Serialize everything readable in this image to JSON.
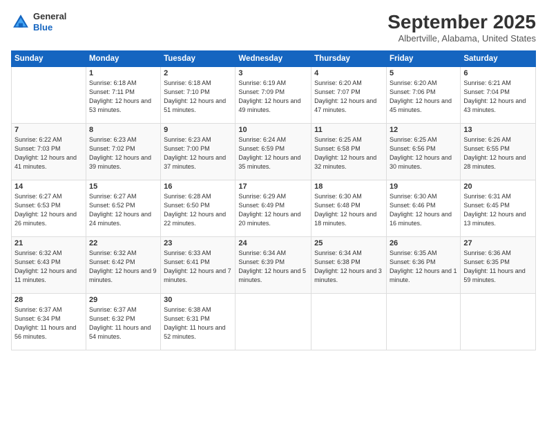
{
  "header": {
    "logo": {
      "general": "General",
      "blue": "Blue"
    },
    "title": "September 2025",
    "location": "Albertville, Alabama, United States"
  },
  "weekdays": [
    "Sunday",
    "Monday",
    "Tuesday",
    "Wednesday",
    "Thursday",
    "Friday",
    "Saturday"
  ],
  "weeks": [
    [
      {
        "day": "",
        "info": ""
      },
      {
        "day": "1",
        "info": "Sunrise: 6:18 AM\nSunset: 7:11 PM\nDaylight: 12 hours\nand 53 minutes."
      },
      {
        "day": "2",
        "info": "Sunrise: 6:18 AM\nSunset: 7:10 PM\nDaylight: 12 hours\nand 51 minutes."
      },
      {
        "day": "3",
        "info": "Sunrise: 6:19 AM\nSunset: 7:09 PM\nDaylight: 12 hours\nand 49 minutes."
      },
      {
        "day": "4",
        "info": "Sunrise: 6:20 AM\nSunset: 7:07 PM\nDaylight: 12 hours\nand 47 minutes."
      },
      {
        "day": "5",
        "info": "Sunrise: 6:20 AM\nSunset: 7:06 PM\nDaylight: 12 hours\nand 45 minutes."
      },
      {
        "day": "6",
        "info": "Sunrise: 6:21 AM\nSunset: 7:04 PM\nDaylight: 12 hours\nand 43 minutes."
      }
    ],
    [
      {
        "day": "7",
        "info": "Sunrise: 6:22 AM\nSunset: 7:03 PM\nDaylight: 12 hours\nand 41 minutes."
      },
      {
        "day": "8",
        "info": "Sunrise: 6:23 AM\nSunset: 7:02 PM\nDaylight: 12 hours\nand 39 minutes."
      },
      {
        "day": "9",
        "info": "Sunrise: 6:23 AM\nSunset: 7:00 PM\nDaylight: 12 hours\nand 37 minutes."
      },
      {
        "day": "10",
        "info": "Sunrise: 6:24 AM\nSunset: 6:59 PM\nDaylight: 12 hours\nand 35 minutes."
      },
      {
        "day": "11",
        "info": "Sunrise: 6:25 AM\nSunset: 6:58 PM\nDaylight: 12 hours\nand 32 minutes."
      },
      {
        "day": "12",
        "info": "Sunrise: 6:25 AM\nSunset: 6:56 PM\nDaylight: 12 hours\nand 30 minutes."
      },
      {
        "day": "13",
        "info": "Sunrise: 6:26 AM\nSunset: 6:55 PM\nDaylight: 12 hours\nand 28 minutes."
      }
    ],
    [
      {
        "day": "14",
        "info": "Sunrise: 6:27 AM\nSunset: 6:53 PM\nDaylight: 12 hours\nand 26 minutes."
      },
      {
        "day": "15",
        "info": "Sunrise: 6:27 AM\nSunset: 6:52 PM\nDaylight: 12 hours\nand 24 minutes."
      },
      {
        "day": "16",
        "info": "Sunrise: 6:28 AM\nSunset: 6:50 PM\nDaylight: 12 hours\nand 22 minutes."
      },
      {
        "day": "17",
        "info": "Sunrise: 6:29 AM\nSunset: 6:49 PM\nDaylight: 12 hours\nand 20 minutes."
      },
      {
        "day": "18",
        "info": "Sunrise: 6:30 AM\nSunset: 6:48 PM\nDaylight: 12 hours\nand 18 minutes."
      },
      {
        "day": "19",
        "info": "Sunrise: 6:30 AM\nSunset: 6:46 PM\nDaylight: 12 hours\nand 16 minutes."
      },
      {
        "day": "20",
        "info": "Sunrise: 6:31 AM\nSunset: 6:45 PM\nDaylight: 12 hours\nand 13 minutes."
      }
    ],
    [
      {
        "day": "21",
        "info": "Sunrise: 6:32 AM\nSunset: 6:43 PM\nDaylight: 12 hours\nand 11 minutes."
      },
      {
        "day": "22",
        "info": "Sunrise: 6:32 AM\nSunset: 6:42 PM\nDaylight: 12 hours\nand 9 minutes."
      },
      {
        "day": "23",
        "info": "Sunrise: 6:33 AM\nSunset: 6:41 PM\nDaylight: 12 hours\nand 7 minutes."
      },
      {
        "day": "24",
        "info": "Sunrise: 6:34 AM\nSunset: 6:39 PM\nDaylight: 12 hours\nand 5 minutes."
      },
      {
        "day": "25",
        "info": "Sunrise: 6:34 AM\nSunset: 6:38 PM\nDaylight: 12 hours\nand 3 minutes."
      },
      {
        "day": "26",
        "info": "Sunrise: 6:35 AM\nSunset: 6:36 PM\nDaylight: 12 hours\nand 1 minute."
      },
      {
        "day": "27",
        "info": "Sunrise: 6:36 AM\nSunset: 6:35 PM\nDaylight: 11 hours\nand 59 minutes."
      }
    ],
    [
      {
        "day": "28",
        "info": "Sunrise: 6:37 AM\nSunset: 6:34 PM\nDaylight: 11 hours\nand 56 minutes."
      },
      {
        "day": "29",
        "info": "Sunrise: 6:37 AM\nSunset: 6:32 PM\nDaylight: 11 hours\nand 54 minutes."
      },
      {
        "day": "30",
        "info": "Sunrise: 6:38 AM\nSunset: 6:31 PM\nDaylight: 11 hours\nand 52 minutes."
      },
      {
        "day": "",
        "info": ""
      },
      {
        "day": "",
        "info": ""
      },
      {
        "day": "",
        "info": ""
      },
      {
        "day": "",
        "info": ""
      }
    ]
  ]
}
